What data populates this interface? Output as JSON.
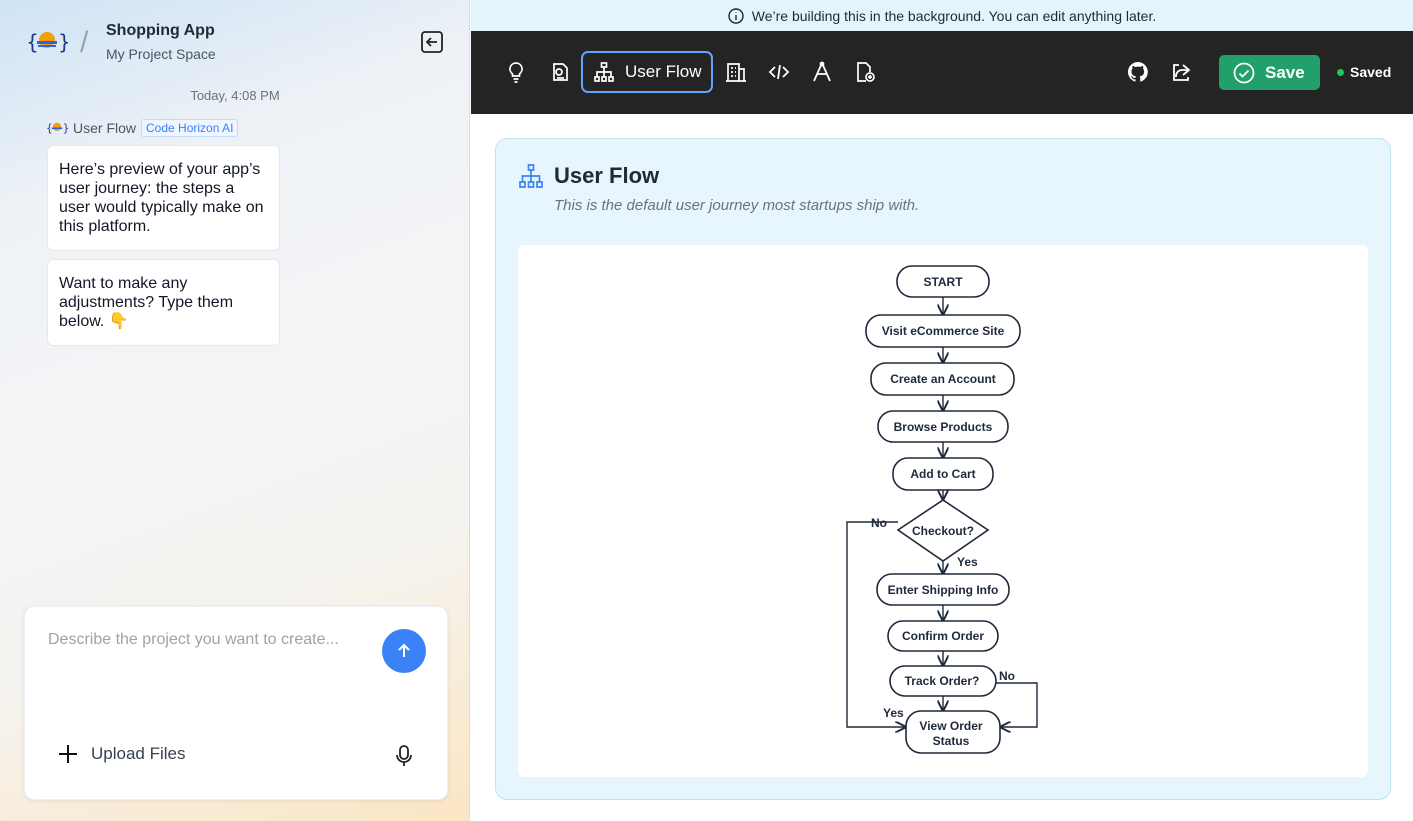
{
  "project": {
    "title": "Shopping App",
    "space": "My Project Space"
  },
  "chat": {
    "timestamp": "Today, 4:08 PM",
    "sender": "User Flow",
    "sender_tag": "Code Horizon AI",
    "messages": [
      "Here’s preview of your app’s user journey: the steps a user would typically make on this platform.",
      "Want to make any adjustments? Type them below. 👇"
    ]
  },
  "composer": {
    "placeholder": "Describe the project you want to create...",
    "upload_label": "Upload Files"
  },
  "banner": {
    "text": "We’re building this in the background. You can edit anything later."
  },
  "toolbar": {
    "active_tab": "User Flow",
    "save_label": "Save",
    "status": "Saved",
    "icons": [
      "lightbulb-icon",
      "document-icon",
      "sitemap-icon",
      "building-icon",
      "code-icon",
      "design-icon",
      "file-add-icon",
      "github-icon",
      "share-icon"
    ]
  },
  "user_flow": {
    "title": "User Flow",
    "subtitle": "This is the default user journey most startups ship with.",
    "nodes": {
      "start": "START",
      "visit": "Visit eCommerce Site",
      "account": "Create an Account",
      "browse": "Browse Products",
      "cart": "Add to Cart",
      "checkout": "Checkout?",
      "shipping": "Enter Shipping Info",
      "confirm": "Confirm Order",
      "track": "Track Order?",
      "status_line1": "View Order",
      "status_line2": "Status"
    },
    "edges": {
      "no": "No",
      "yes": "Yes"
    }
  },
  "colors": {
    "accent": "#3b82f6",
    "save": "#22a06b",
    "toolbar_bg": "#242424",
    "card_bg": "#e6f6fc"
  }
}
